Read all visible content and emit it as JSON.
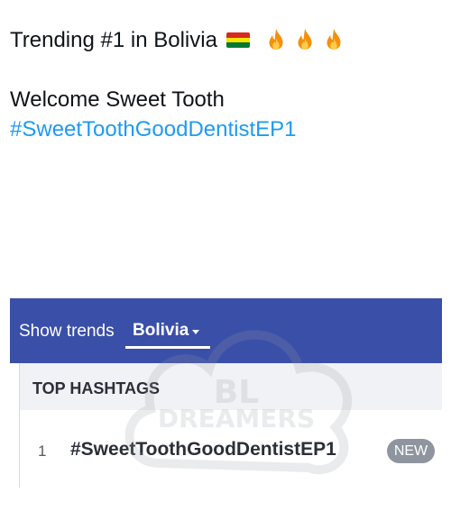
{
  "post": {
    "line1": "Trending #1 in Bolivia",
    "flag": "bolivia-flag",
    "emoji": "fire-icon",
    "emoji_count": 3,
    "line2": "Welcome Sweet Tooth",
    "hashtag": "#SweetToothGoodDentistEP1"
  },
  "trends_widget": {
    "show_trends_label": "Show trends",
    "country": "Bolivia",
    "section_title": "TOP HASHTAGS",
    "items": [
      {
        "rank": "1",
        "tag": "#SweetToothGoodDentistEP1",
        "badge": "NEW"
      }
    ]
  },
  "watermark": {
    "line1": "BL",
    "line2": "DREAMERS"
  },
  "colors": {
    "hashtag": "#1d9bf0",
    "bar": "#3a4fa8",
    "header_bg": "#f1f2f5",
    "badge": "#8f959f"
  }
}
